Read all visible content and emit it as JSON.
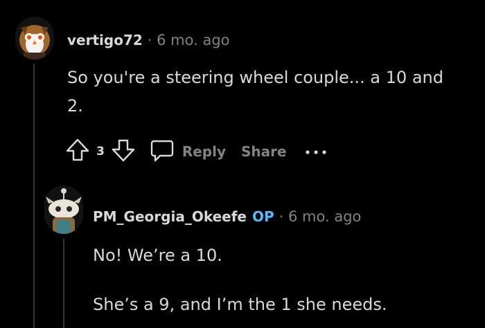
{
  "comment1": {
    "username": "vertigo72",
    "separator": "·",
    "time": "6 mo. ago",
    "body_line1": "So you're a steering wheel couple... a 10 and",
    "body_line2": "2.",
    "upvote_icon": "upvote-arrow-icon",
    "downvote_icon": "downvote-arrow-icon",
    "vote_count": "3",
    "reply_icon": "speech-bubble-icon",
    "reply_label": "Reply",
    "share_label": "Share",
    "more_icon": "ellipsis-icon"
  },
  "comment2": {
    "username": "PM_Georgia_Okeefe",
    "op_badge": "OP",
    "separator": "·",
    "time": "6 mo. ago",
    "body_line1": "No! We’re a 10.",
    "body_line2": "She’s a 9, and I’m the 1 she needs."
  },
  "colors": {
    "background": "#000000",
    "text": "#d7dadc",
    "muted": "#818384",
    "op_accent": "#4fbcff",
    "thread_line": "#343536"
  }
}
